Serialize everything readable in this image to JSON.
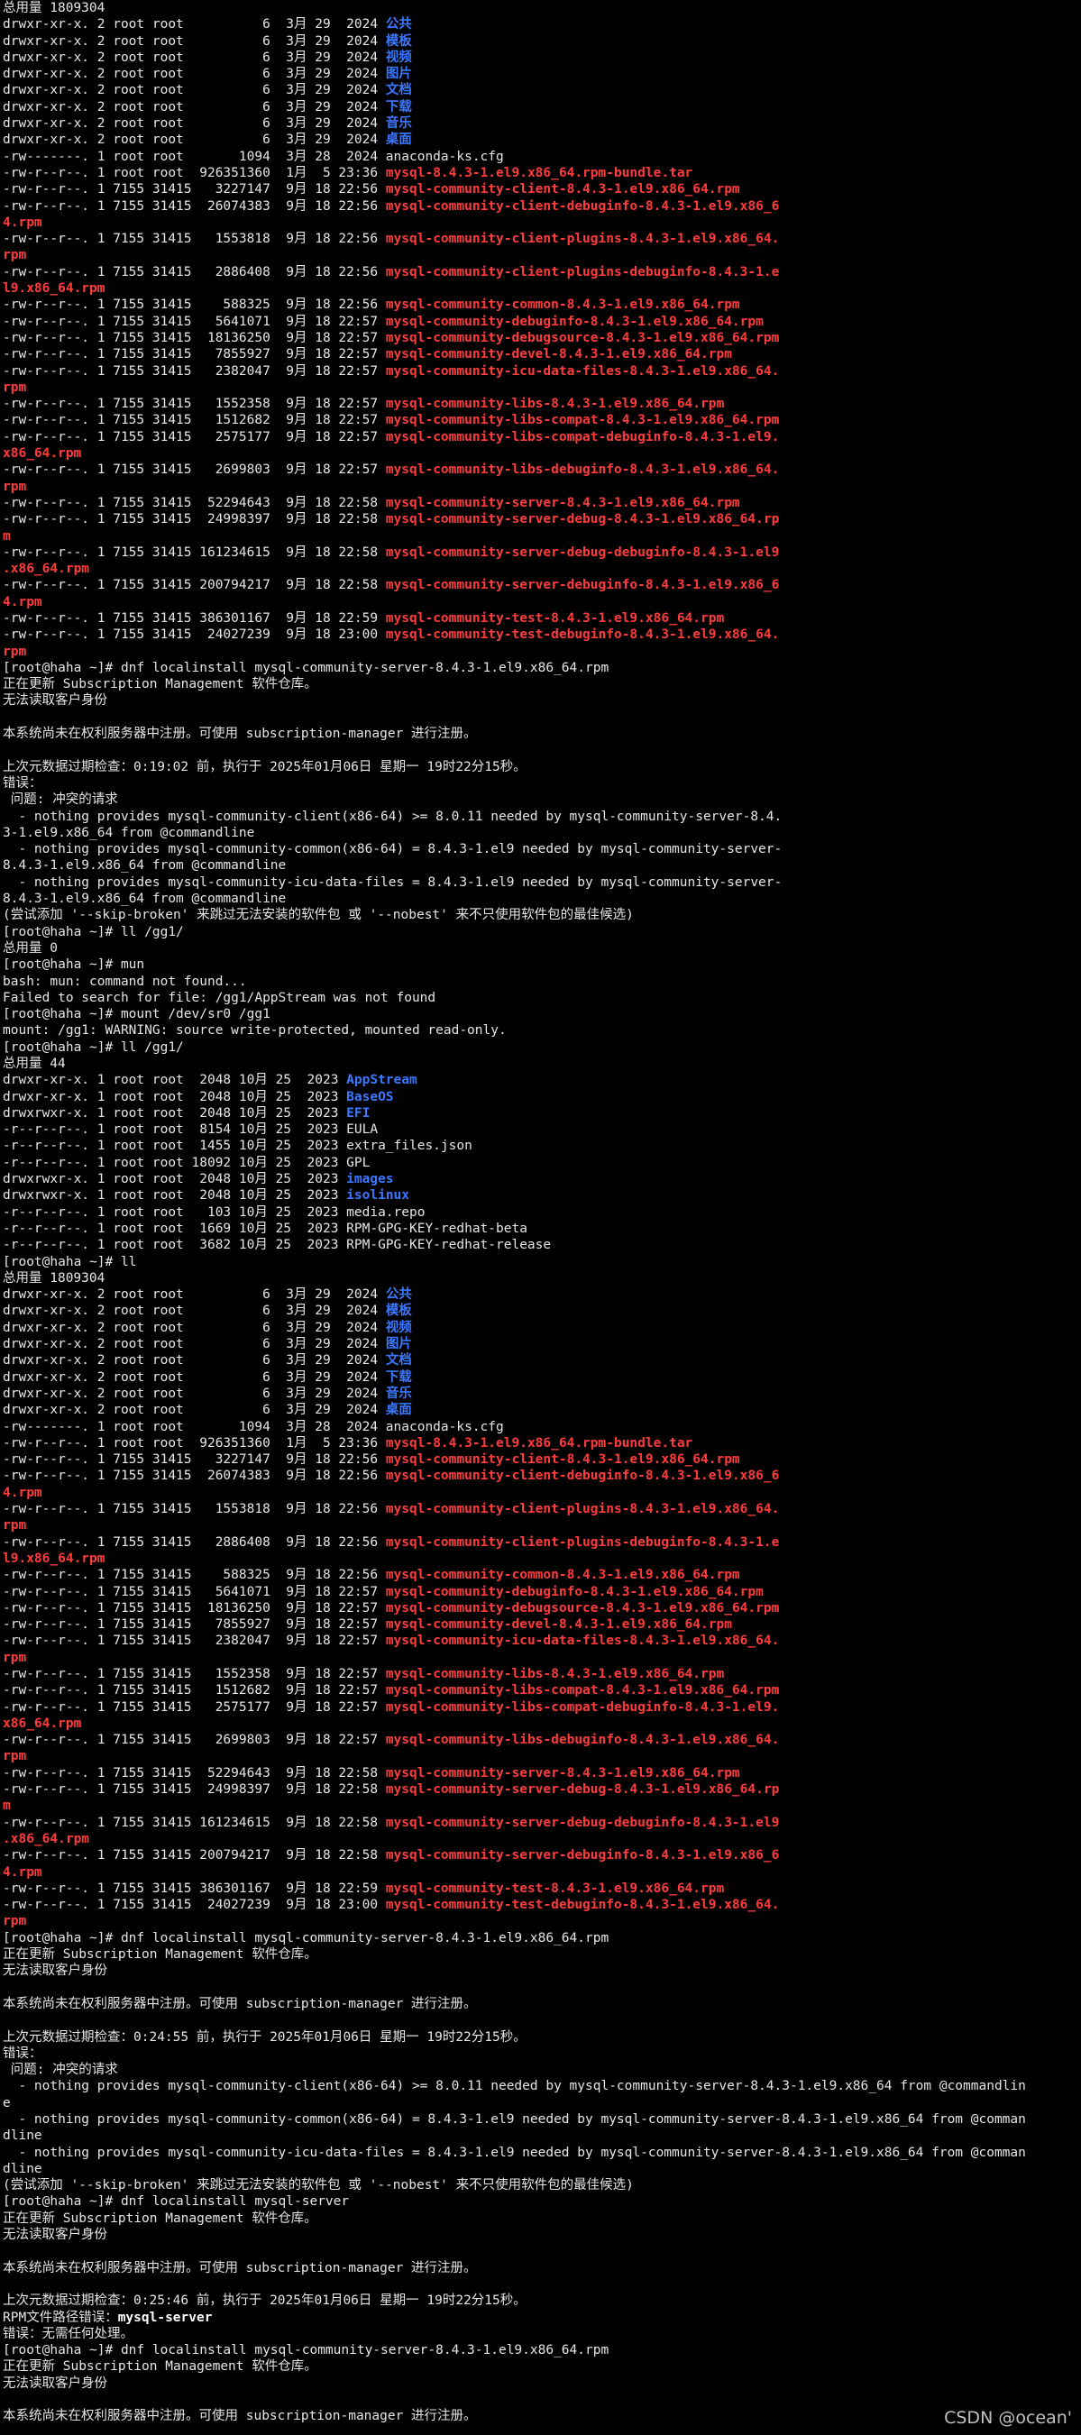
{
  "colors": {
    "background": "#000000",
    "text": "#e6e6e6",
    "directory": "#3b78ff",
    "archive": "#ff3b3b"
  },
  "watermark": "CSDN @ocean'",
  "lines": [
    [
      {
        "t": "总用量 1809304"
      }
    ],
    [
      {
        "t": "drwxr-xr-x. 2 root root          6  3月 29  2024 "
      },
      {
        "t": "公共",
        "c": "blue"
      }
    ],
    [
      {
        "t": "drwxr-xr-x. 2 root root          6  3月 29  2024 "
      },
      {
        "t": "模板",
        "c": "blue"
      }
    ],
    [
      {
        "t": "drwxr-xr-x. 2 root root          6  3月 29  2024 "
      },
      {
        "t": "视频",
        "c": "blue"
      }
    ],
    [
      {
        "t": "drwxr-xr-x. 2 root root          6  3月 29  2024 "
      },
      {
        "t": "图片",
        "c": "blue"
      }
    ],
    [
      {
        "t": "drwxr-xr-x. 2 root root          6  3月 29  2024 "
      },
      {
        "t": "文档",
        "c": "blue"
      }
    ],
    [
      {
        "t": "drwxr-xr-x. 2 root root          6  3月 29  2024 "
      },
      {
        "t": "下载",
        "c": "blue"
      }
    ],
    [
      {
        "t": "drwxr-xr-x. 2 root root          6  3月 29  2024 "
      },
      {
        "t": "音乐",
        "c": "blue"
      }
    ],
    [
      {
        "t": "drwxr-xr-x. 2 root root          6  3月 29  2024 "
      },
      {
        "t": "桌面",
        "c": "blue"
      }
    ],
    [
      {
        "t": "-rw-------. 1 root root       1094  3月 28  2024 anaconda-ks.cfg"
      }
    ],
    [
      {
        "t": "-rw-r--r--. 1 root root  926351360  1月  5 23:36 "
      },
      {
        "t": "mysql-8.4.3-1.el9.x86_64.rpm-bundle.tar",
        "c": "red"
      }
    ],
    [
      {
        "t": "-rw-r--r--. 1 7155 31415   3227147  9月 18 22:56 "
      },
      {
        "t": "mysql-community-client-8.4.3-1.el9.x86_64.rpm",
        "c": "red"
      }
    ],
    [
      {
        "t": "-rw-r--r--. 1 7155 31415  26074383  9月 18 22:56 "
      },
      {
        "t": "mysql-community-client-debuginfo-8.4.3-1.el9.x86_6",
        "c": "red"
      }
    ],
    [
      {
        "t": "4.rpm",
        "c": "red"
      }
    ],
    [
      {
        "t": "-rw-r--r--. 1 7155 31415   1553818  9月 18 22:56 "
      },
      {
        "t": "mysql-community-client-plugins-8.4.3-1.el9.x86_64.",
        "c": "red"
      }
    ],
    [
      {
        "t": "rpm",
        "c": "red"
      }
    ],
    [
      {
        "t": "-rw-r--r--. 1 7155 31415   2886408  9月 18 22:56 "
      },
      {
        "t": "mysql-community-client-plugins-debuginfo-8.4.3-1.e",
        "c": "red"
      }
    ],
    [
      {
        "t": "l9.x86_64.rpm",
        "c": "red"
      }
    ],
    [
      {
        "t": "-rw-r--r--. 1 7155 31415    588325  9月 18 22:56 "
      },
      {
        "t": "mysql-community-common-8.4.3-1.el9.x86_64.rpm",
        "c": "red"
      }
    ],
    [
      {
        "t": "-rw-r--r--. 1 7155 31415   5641071  9月 18 22:57 "
      },
      {
        "t": "mysql-community-debuginfo-8.4.3-1.el9.x86_64.rpm",
        "c": "red"
      }
    ],
    [
      {
        "t": "-rw-r--r--. 1 7155 31415  18136250  9月 18 22:57 "
      },
      {
        "t": "mysql-community-debugsource-8.4.3-1.el9.x86_64.rpm",
        "c": "red"
      }
    ],
    [
      {
        "t": "-rw-r--r--. 1 7155 31415   7855927  9月 18 22:57 "
      },
      {
        "t": "mysql-community-devel-8.4.3-1.el9.x86_64.rpm",
        "c": "red"
      }
    ],
    [
      {
        "t": "-rw-r--r--. 1 7155 31415   2382047  9月 18 22:57 "
      },
      {
        "t": "mysql-community-icu-data-files-8.4.3-1.el9.x86_64.",
        "c": "red"
      }
    ],
    [
      {
        "t": "rpm",
        "c": "red"
      }
    ],
    [
      {
        "t": "-rw-r--r--. 1 7155 31415   1552358  9月 18 22:57 "
      },
      {
        "t": "mysql-community-libs-8.4.3-1.el9.x86_64.rpm",
        "c": "red"
      }
    ],
    [
      {
        "t": "-rw-r--r--. 1 7155 31415   1512682  9月 18 22:57 "
      },
      {
        "t": "mysql-community-libs-compat-8.4.3-1.el9.x86_64.rpm",
        "c": "red"
      }
    ],
    [
      {
        "t": "-rw-r--r--. 1 7155 31415   2575177  9月 18 22:57 "
      },
      {
        "t": "mysql-community-libs-compat-debuginfo-8.4.3-1.el9.",
        "c": "red"
      }
    ],
    [
      {
        "t": "x86_64.rpm",
        "c": "red"
      }
    ],
    [
      {
        "t": "-rw-r--r--. 1 7155 31415   2699803  9月 18 22:57 "
      },
      {
        "t": "mysql-community-libs-debuginfo-8.4.3-1.el9.x86_64.",
        "c": "red"
      }
    ],
    [
      {
        "t": "rpm",
        "c": "red"
      }
    ],
    [
      {
        "t": "-rw-r--r--. 1 7155 31415  52294643  9月 18 22:58 "
      },
      {
        "t": "mysql-community-server-8.4.3-1.el9.x86_64.rpm",
        "c": "red"
      }
    ],
    [
      {
        "t": "-rw-r--r--. 1 7155 31415  24998397  9月 18 22:58 "
      },
      {
        "t": "mysql-community-server-debug-8.4.3-1.el9.x86_64.rp",
        "c": "red"
      }
    ],
    [
      {
        "t": "m",
        "c": "red"
      }
    ],
    [
      {
        "t": "-rw-r--r--. 1 7155 31415 161234615  9月 18 22:58 "
      },
      {
        "t": "mysql-community-server-debug-debuginfo-8.4.3-1.el9",
        "c": "red"
      }
    ],
    [
      {
        "t": ".x86_64.rpm",
        "c": "red"
      }
    ],
    [
      {
        "t": "-rw-r--r--. 1 7155 31415 200794217  9月 18 22:58 "
      },
      {
        "t": "mysql-community-server-debuginfo-8.4.3-1.el9.x86_6",
        "c": "red"
      }
    ],
    [
      {
        "t": "4.rpm",
        "c": "red"
      }
    ],
    [
      {
        "t": "-rw-r--r--. 1 7155 31415 386301167  9月 18 22:59 "
      },
      {
        "t": "mysql-community-test-8.4.3-1.el9.x86_64.rpm",
        "c": "red"
      }
    ],
    [
      {
        "t": "-rw-r--r--. 1 7155 31415  24027239  9月 18 23:00 "
      },
      {
        "t": "mysql-community-test-debuginfo-8.4.3-1.el9.x86_64.",
        "c": "red"
      }
    ],
    [
      {
        "t": "rpm",
        "c": "red"
      }
    ],
    [
      {
        "t": "[root@haha ~]# dnf localinstall mysql-community-server-8.4.3-1.el9.x86_64.rpm"
      }
    ],
    [
      {
        "t": "正在更新 Subscription Management 软件仓库。"
      }
    ],
    [
      {
        "t": "无法读取客户身份"
      }
    ],
    [
      {
        "t": ""
      }
    ],
    [
      {
        "t": "本系统尚未在权利服务器中注册。可使用 subscription-manager 进行注册。"
      }
    ],
    [
      {
        "t": ""
      }
    ],
    [
      {
        "t": "上次元数据过期检查：0:19:02 前，执行于 2025年01月06日 星期一 19时22分15秒。"
      }
    ],
    [
      {
        "t": "错误："
      }
    ],
    [
      {
        "t": " 问题: 冲突的请求"
      }
    ],
    [
      {
        "t": "  - nothing provides mysql-community-client(x86-64) >= 8.0.11 needed by mysql-community-server-8.4."
      }
    ],
    [
      {
        "t": "3-1.el9.x86_64 from @commandline"
      }
    ],
    [
      {
        "t": "  - nothing provides mysql-community-common(x86-64) = 8.4.3-1.el9 needed by mysql-community-server-"
      }
    ],
    [
      {
        "t": "8.4.3-1.el9.x86_64 from @commandline"
      }
    ],
    [
      {
        "t": "  - nothing provides mysql-community-icu-data-files = 8.4.3-1.el9 needed by mysql-community-server-"
      }
    ],
    [
      {
        "t": "8.4.3-1.el9.x86_64 from @commandline"
      }
    ],
    [
      {
        "t": "(尝试添加 '--skip-broken' 来跳过无法安装的软件包 或 '--nobest' 来不只使用软件包的最佳候选)"
      }
    ],
    [
      {
        "t": "[root@haha ~]# ll /gg1/"
      }
    ],
    [
      {
        "t": "总用量 0"
      }
    ],
    [
      {
        "t": "[root@haha ~]# mun"
      }
    ],
    [
      {
        "t": "bash: mun: command not found..."
      }
    ],
    [
      {
        "t": "Failed to search for file: /gg1/AppStream was not found"
      }
    ],
    [
      {
        "t": "[root@haha ~]# mount /dev/sr0 /gg1"
      }
    ],
    [
      {
        "t": "mount: /gg1: WARNING: source write-protected, mounted read-only."
      }
    ],
    [
      {
        "t": "[root@haha ~]# ll /gg1/"
      }
    ],
    [
      {
        "t": "总用量 44"
      }
    ],
    [
      {
        "t": "drwxr-xr-x. 1 root root  2048 10月 25  2023 "
      },
      {
        "t": "AppStream",
        "c": "blue"
      }
    ],
    [
      {
        "t": "drwxr-xr-x. 1 root root  2048 10月 25  2023 "
      },
      {
        "t": "BaseOS",
        "c": "blue"
      }
    ],
    [
      {
        "t": "drwxrwxr-x. 1 root root  2048 10月 25  2023 "
      },
      {
        "t": "EFI",
        "c": "blue"
      }
    ],
    [
      {
        "t": "-r--r--r--. 1 root root  8154 10月 25  2023 EULA"
      }
    ],
    [
      {
        "t": "-r--r--r--. 1 root root  1455 10月 25  2023 extra_files.json"
      }
    ],
    [
      {
        "t": "-r--r--r--. 1 root root 18092 10月 25  2023 GPL"
      }
    ],
    [
      {
        "t": "drwxrwxr-x. 1 root root  2048 10月 25  2023 "
      },
      {
        "t": "images",
        "c": "blue"
      }
    ],
    [
      {
        "t": "drwxrwxr-x. 1 root root  2048 10月 25  2023 "
      },
      {
        "t": "isolinux",
        "c": "blue"
      }
    ],
    [
      {
        "t": "-r--r--r--. 1 root root   103 10月 25  2023 media.repo"
      }
    ],
    [
      {
        "t": "-r--r--r--. 1 root root  1669 10月 25  2023 RPM-GPG-KEY-redhat-beta"
      }
    ],
    [
      {
        "t": "-r--r--r--. 1 root root  3682 10月 25  2023 RPM-GPG-KEY-redhat-release"
      }
    ],
    [
      {
        "t": "[root@haha ~]# ll"
      }
    ],
    [
      {
        "t": "总用量 1809304"
      }
    ],
    [
      {
        "t": "drwxr-xr-x. 2 root root          6  3月 29  2024 "
      },
      {
        "t": "公共",
        "c": "blue"
      }
    ],
    [
      {
        "t": "drwxr-xr-x. 2 root root          6  3月 29  2024 "
      },
      {
        "t": "模板",
        "c": "blue"
      }
    ],
    [
      {
        "t": "drwxr-xr-x. 2 root root          6  3月 29  2024 "
      },
      {
        "t": "视频",
        "c": "blue"
      }
    ],
    [
      {
        "t": "drwxr-xr-x. 2 root root          6  3月 29  2024 "
      },
      {
        "t": "图片",
        "c": "blue"
      }
    ],
    [
      {
        "t": "drwxr-xr-x. 2 root root          6  3月 29  2024 "
      },
      {
        "t": "文档",
        "c": "blue"
      }
    ],
    [
      {
        "t": "drwxr-xr-x. 2 root root          6  3月 29  2024 "
      },
      {
        "t": "下载",
        "c": "blue"
      }
    ],
    [
      {
        "t": "drwxr-xr-x. 2 root root          6  3月 29  2024 "
      },
      {
        "t": "音乐",
        "c": "blue"
      }
    ],
    [
      {
        "t": "drwxr-xr-x. 2 root root          6  3月 29  2024 "
      },
      {
        "t": "桌面",
        "c": "blue"
      }
    ],
    [
      {
        "t": "-rw-------. 1 root root       1094  3月 28  2024 anaconda-ks.cfg"
      }
    ],
    [
      {
        "t": "-rw-r--r--. 1 root root  926351360  1月  5 23:36 "
      },
      {
        "t": "mysql-8.4.3-1.el9.x86_64.rpm-bundle.tar",
        "c": "red"
      }
    ],
    [
      {
        "t": "-rw-r--r--. 1 7155 31415   3227147  9月 18 22:56 "
      },
      {
        "t": "mysql-community-client-8.4.3-1.el9.x86_64.rpm",
        "c": "red"
      }
    ],
    [
      {
        "t": "-rw-r--r--. 1 7155 31415  26074383  9月 18 22:56 "
      },
      {
        "t": "mysql-community-client-debuginfo-8.4.3-1.el9.x86_6",
        "c": "red"
      }
    ],
    [
      {
        "t": "4.rpm",
        "c": "red"
      }
    ],
    [
      {
        "t": "-rw-r--r--. 1 7155 31415   1553818  9月 18 22:56 "
      },
      {
        "t": "mysql-community-client-plugins-8.4.3-1.el9.x86_64.",
        "c": "red"
      }
    ],
    [
      {
        "t": "rpm",
        "c": "red"
      }
    ],
    [
      {
        "t": "-rw-r--r--. 1 7155 31415   2886408  9月 18 22:56 "
      },
      {
        "t": "mysql-community-client-plugins-debuginfo-8.4.3-1.e",
        "c": "red"
      }
    ],
    [
      {
        "t": "l9.x86_64.rpm",
        "c": "red"
      }
    ],
    [
      {
        "t": "-rw-r--r--. 1 7155 31415    588325  9月 18 22:56 "
      },
      {
        "t": "mysql-community-common-8.4.3-1.el9.x86_64.rpm",
        "c": "red"
      }
    ],
    [
      {
        "t": "-rw-r--r--. 1 7155 31415   5641071  9月 18 22:57 "
      },
      {
        "t": "mysql-community-debuginfo-8.4.3-1.el9.x86_64.rpm",
        "c": "red"
      }
    ],
    [
      {
        "t": "-rw-r--r--. 1 7155 31415  18136250  9月 18 22:57 "
      },
      {
        "t": "mysql-community-debugsource-8.4.3-1.el9.x86_64.rpm",
        "c": "red"
      }
    ],
    [
      {
        "t": "-rw-r--r--. 1 7155 31415   7855927  9月 18 22:57 "
      },
      {
        "t": "mysql-community-devel-8.4.3-1.el9.x86_64.rpm",
        "c": "red"
      }
    ],
    [
      {
        "t": "-rw-r--r--. 1 7155 31415   2382047  9月 18 22:57 "
      },
      {
        "t": "mysql-community-icu-data-files-8.4.3-1.el9.x86_64.",
        "c": "red"
      }
    ],
    [
      {
        "t": "rpm",
        "c": "red"
      }
    ],
    [
      {
        "t": "-rw-r--r--. 1 7155 31415   1552358  9月 18 22:57 "
      },
      {
        "t": "mysql-community-libs-8.4.3-1.el9.x86_64.rpm",
        "c": "red"
      }
    ],
    [
      {
        "t": "-rw-r--r--. 1 7155 31415   1512682  9月 18 22:57 "
      },
      {
        "t": "mysql-community-libs-compat-8.4.3-1.el9.x86_64.rpm",
        "c": "red"
      }
    ],
    [
      {
        "t": "-rw-r--r--. 1 7155 31415   2575177  9月 18 22:57 "
      },
      {
        "t": "mysql-community-libs-compat-debuginfo-8.4.3-1.el9.",
        "c": "red"
      }
    ],
    [
      {
        "t": "x86_64.rpm",
        "c": "red"
      }
    ],
    [
      {
        "t": "-rw-r--r--. 1 7155 31415   2699803  9月 18 22:57 "
      },
      {
        "t": "mysql-community-libs-debuginfo-8.4.3-1.el9.x86_64.",
        "c": "red"
      }
    ],
    [
      {
        "t": "rpm",
        "c": "red"
      }
    ],
    [
      {
        "t": "-rw-r--r--. 1 7155 31415  52294643  9月 18 22:58 "
      },
      {
        "t": "mysql-community-server-8.4.3-1.el9.x86_64.rpm",
        "c": "red"
      }
    ],
    [
      {
        "t": "-rw-r--r--. 1 7155 31415  24998397  9月 18 22:58 "
      },
      {
        "t": "mysql-community-server-debug-8.4.3-1.el9.x86_64.rp",
        "c": "red"
      }
    ],
    [
      {
        "t": "m",
        "c": "red"
      }
    ],
    [
      {
        "t": "-rw-r--r--. 1 7155 31415 161234615  9月 18 22:58 "
      },
      {
        "t": "mysql-community-server-debug-debuginfo-8.4.3-1.el9",
        "c": "red"
      }
    ],
    [
      {
        "t": ".x86_64.rpm",
        "c": "red"
      }
    ],
    [
      {
        "t": "-rw-r--r--. 1 7155 31415 200794217  9月 18 22:58 "
      },
      {
        "t": "mysql-community-server-debuginfo-8.4.3-1.el9.x86_6",
        "c": "red"
      }
    ],
    [
      {
        "t": "4.rpm",
        "c": "red"
      }
    ],
    [
      {
        "t": "-rw-r--r--. 1 7155 31415 386301167  9月 18 22:59 "
      },
      {
        "t": "mysql-community-test-8.4.3-1.el9.x86_64.rpm",
        "c": "red"
      }
    ],
    [
      {
        "t": "-rw-r--r--. 1 7155 31415  24027239  9月 18 23:00 "
      },
      {
        "t": "mysql-community-test-debuginfo-8.4.3-1.el9.x86_64.",
        "c": "red"
      }
    ],
    [
      {
        "t": "rpm",
        "c": "red"
      }
    ],
    [
      {
        "t": "[root@haha ~]# dnf localinstall mysql-community-server-8.4.3-1.el9.x86_64.rpm"
      }
    ],
    [
      {
        "t": "正在更新 Subscription Management 软件仓库。"
      }
    ],
    [
      {
        "t": "无法读取客户身份"
      }
    ],
    [
      {
        "t": ""
      }
    ],
    [
      {
        "t": "本系统尚未在权利服务器中注册。可使用 subscription-manager 进行注册。"
      }
    ],
    [
      {
        "t": ""
      }
    ],
    [
      {
        "t": "上次元数据过期检查：0:24:55 前，执行于 2025年01月06日 星期一 19时22分15秒。"
      }
    ],
    [
      {
        "t": "错误："
      }
    ],
    [
      {
        "t": " 问题: 冲突的请求"
      }
    ],
    [
      {
        "t": "  - nothing provides mysql-community-client(x86-64) >= 8.0.11 needed by mysql-community-server-8.4.3-1.el9.x86_64 from @commandlin"
      }
    ],
    [
      {
        "t": "e"
      }
    ],
    [
      {
        "t": "  - nothing provides mysql-community-common(x86-64) = 8.4.3-1.el9 needed by mysql-community-server-8.4.3-1.el9.x86_64 from @comman"
      }
    ],
    [
      {
        "t": "dline"
      }
    ],
    [
      {
        "t": "  - nothing provides mysql-community-icu-data-files = 8.4.3-1.el9 needed by mysql-community-server-8.4.3-1.el9.x86_64 from @comman"
      }
    ],
    [
      {
        "t": "dline"
      }
    ],
    [
      {
        "t": "(尝试添加 '--skip-broken' 来跳过无法安装的软件包 或 '--nobest' 来不只使用软件包的最佳候选)"
      }
    ],
    [
      {
        "t": "[root@haha ~]# dnf localinstall mysql-server"
      }
    ],
    [
      {
        "t": "正在更新 Subscription Management 软件仓库。"
      }
    ],
    [
      {
        "t": "无法读取客户身份"
      }
    ],
    [
      {
        "t": ""
      }
    ],
    [
      {
        "t": "本系统尚未在权利服务器中注册。可使用 subscription-manager 进行注册。"
      }
    ],
    [
      {
        "t": ""
      }
    ],
    [
      {
        "t": "上次元数据过期检查：0:25:46 前，执行于 2025年01月06日 星期一 19时22分15秒。"
      }
    ],
    [
      {
        "t": "RPM文件路径错误："
      },
      {
        "t": "mysql-server",
        "c": "bold"
      }
    ],
    [
      {
        "t": "错误：无需任何处理。"
      }
    ],
    [
      {
        "t": "[root@haha ~]# dnf localinstall mysql-community-server-8.4.3-1.el9.x86_64.rpm"
      }
    ],
    [
      {
        "t": "正在更新 Subscription Management 软件仓库。"
      }
    ],
    [
      {
        "t": "无法读取客户身份"
      }
    ],
    [
      {
        "t": ""
      }
    ],
    [
      {
        "t": "本系统尚未在权利服务器中注册。可使用 subscription-manager 进行注册。"
      }
    ]
  ]
}
